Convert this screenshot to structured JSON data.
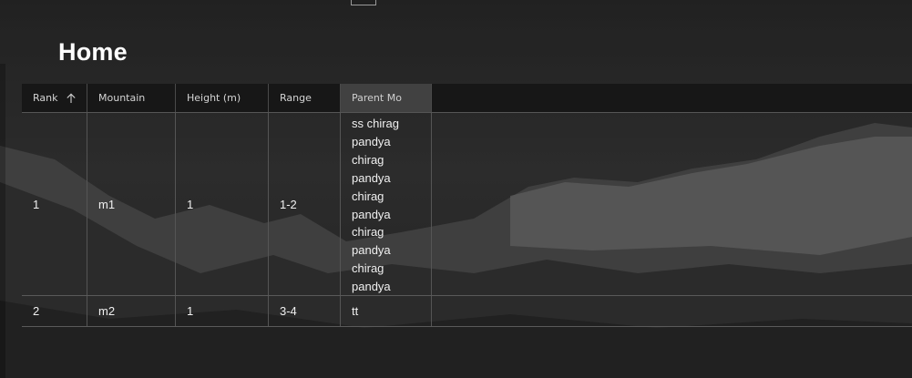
{
  "page": {
    "title": "Home"
  },
  "table": {
    "columns": [
      {
        "key": "rank",
        "label": "Rank",
        "sorted": "ascending"
      },
      {
        "key": "mountain",
        "label": "Mountain"
      },
      {
        "key": "height",
        "label": "Height (m)"
      },
      {
        "key": "range",
        "label": "Range"
      },
      {
        "key": "parent",
        "label": "Parent Mo"
      }
    ],
    "rows": [
      {
        "rank": "1",
        "mountain": "m1",
        "height": "1",
        "range": "1-2",
        "parent": "ss chirag\npandya\nchirag\npandya\nchirag\npandya\nchirag\npandya\nchirag\npandya"
      },
      {
        "rank": "2",
        "mountain": "m2",
        "height": "1",
        "range": "3-4",
        "parent": "tt"
      }
    ]
  },
  "icons": {
    "sort": "arrow-up-icon"
  }
}
